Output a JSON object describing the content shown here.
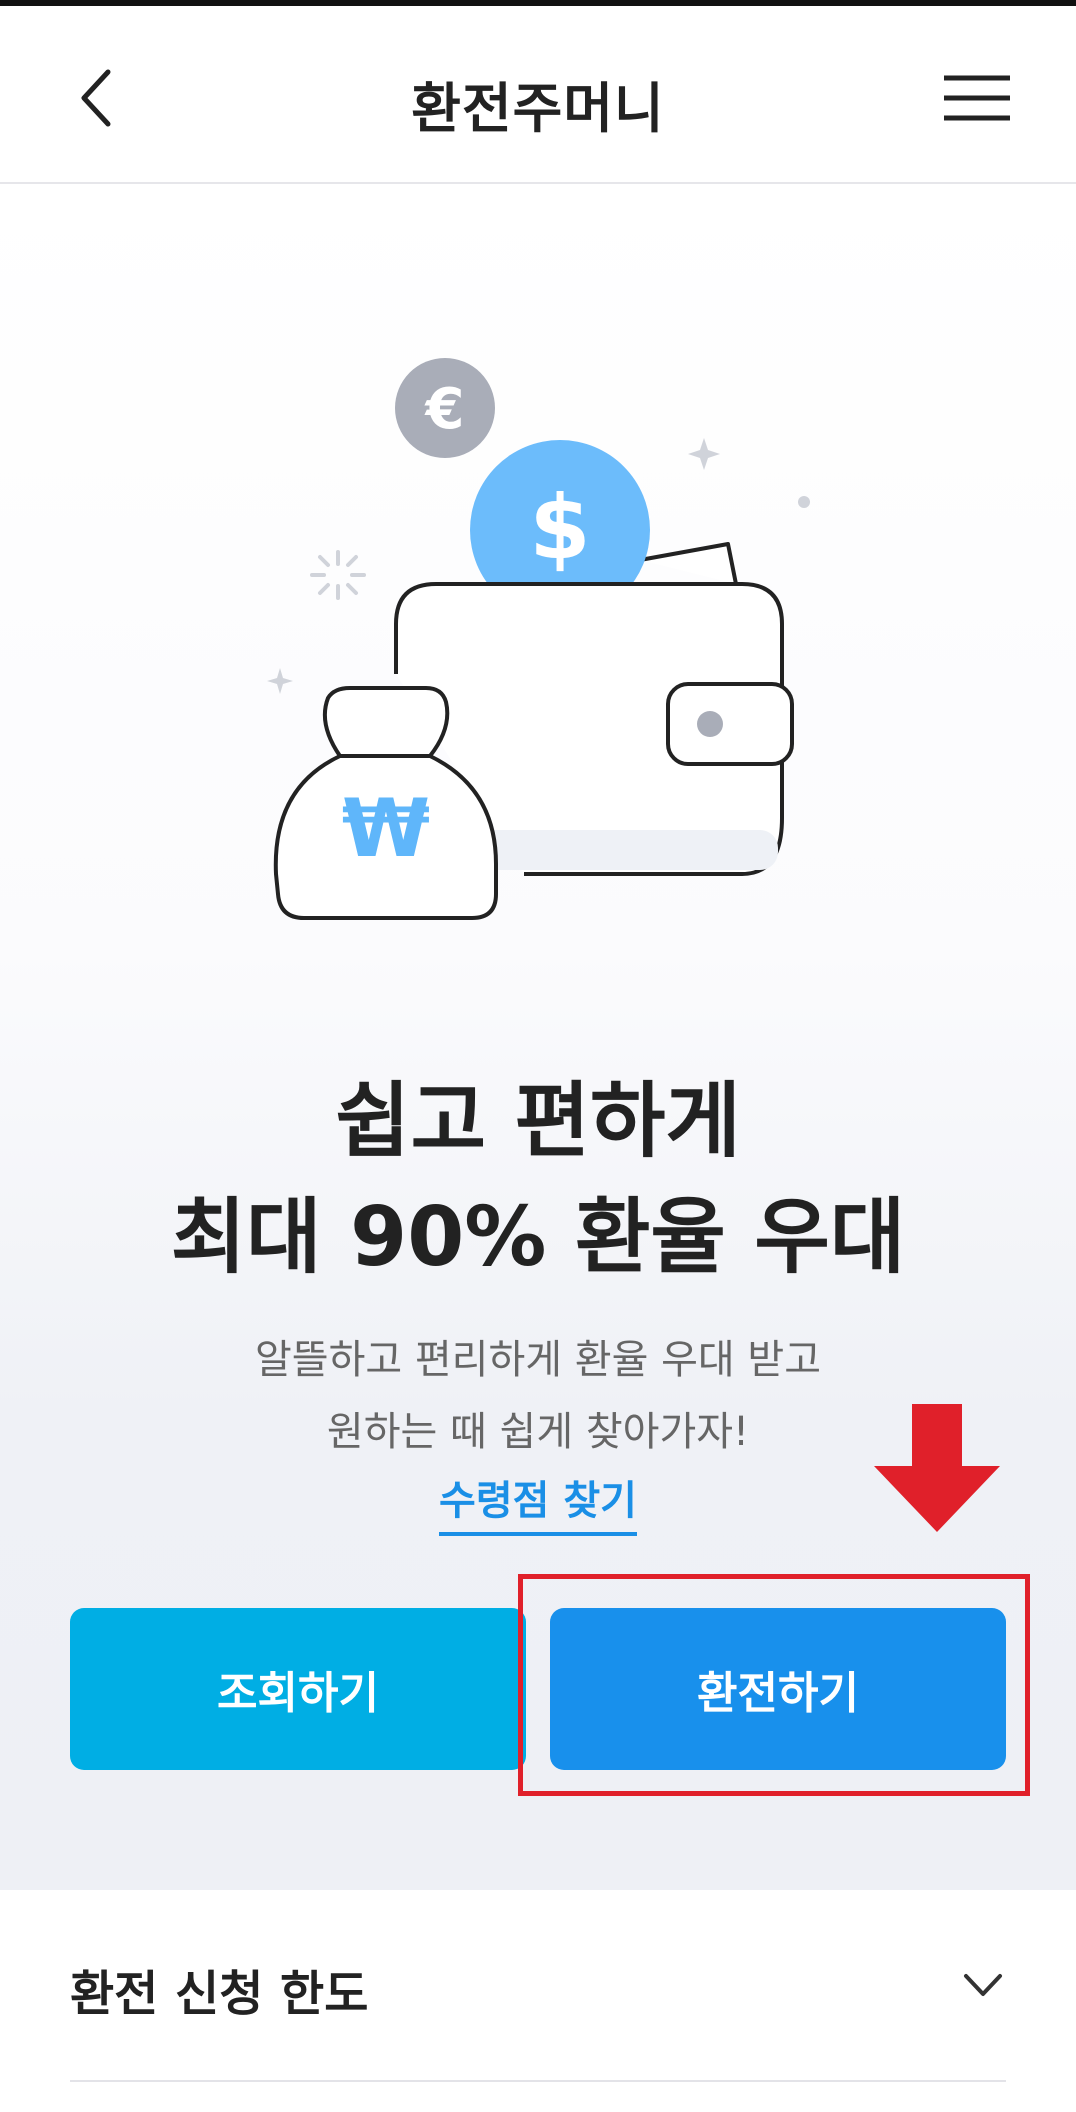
{
  "header": {
    "title": "환전주머니"
  },
  "icons": {
    "back": "chevron-left-icon",
    "menu": "hamburger-menu-icon",
    "accordion": "chevron-down-icon",
    "arrow": "down-arrow-icon"
  },
  "illustration": {
    "coins": {
      "euro": "€",
      "dollar": "$",
      "won": "₩"
    }
  },
  "hero": {
    "headline_line1": "쉽고 편하게",
    "headline_line2": "최대 90% 환율 우대",
    "sub_line1": "알뜰하고 편리하게 환율 우대 받고",
    "sub_line2": "원하는 때 쉽게 찾아가자!",
    "find_link": "수령점 찾기"
  },
  "buttons": {
    "inquiry": "조회하기",
    "exchange": "환전하기"
  },
  "accordion": {
    "limit_title": "환전 신청 한도"
  },
  "colors": {
    "accent_blue": "#1890ec",
    "accent_cyan": "#00aee4",
    "link_blue": "#1a8fe6",
    "highlight_red": "#e0202a",
    "coin_blue": "#6cbcfb",
    "coin_gray": "#a9adb8"
  }
}
